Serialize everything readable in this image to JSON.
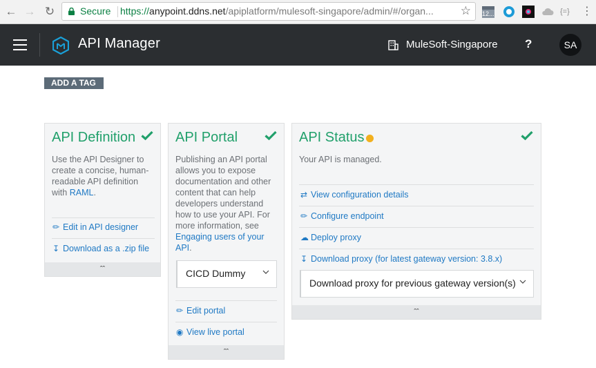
{
  "browser": {
    "secure_label": "Secure",
    "url_scheme": "https://",
    "url_host": "anypoint.ddns.net",
    "url_path": "/apiplatform/mulesoft-singapore/admin/#/organ...",
    "calendar_badge": "12..."
  },
  "header": {
    "app_title": "API Manager",
    "org_name": "MuleSoft-Singapore",
    "help_label": "?",
    "avatar_initials": "SA"
  },
  "tag_button_label": "ADD A TAG",
  "colors": {
    "accent_green": "#21a06b",
    "link_blue": "#1f79c4",
    "status_yellow": "#f2b01e",
    "header_bg": "#2b2e31"
  },
  "cards": {
    "definition": {
      "title": "API Definition",
      "desc_prefix": "Use the API Designer to create a concise, human-readable API definition with ",
      "desc_link": "RAML",
      "desc_suffix": ".",
      "link_edit": "Edit in API designer",
      "link_download": "Download as a .zip file"
    },
    "portal": {
      "title": "API Portal",
      "desc_prefix": "Publishing an API portal allows you to expose documentation and other content that can help developers understand how to use your API. For more information, see ",
      "desc_link": "Engaging users of your API",
      "desc_suffix": ".",
      "portal_select_value": "CICD Dummy",
      "link_edit": "Edit portal",
      "link_view": "View live portal"
    },
    "status": {
      "title": "API Status",
      "desc": "Your API is managed.",
      "link_config": "View configuration details",
      "link_endpoint": "Configure endpoint",
      "link_deploy": "Deploy proxy",
      "link_download": "Download proxy (for latest gateway version: 3.8.x)",
      "previous_select_value": "Download proxy for previous gateway version(s)"
    }
  }
}
